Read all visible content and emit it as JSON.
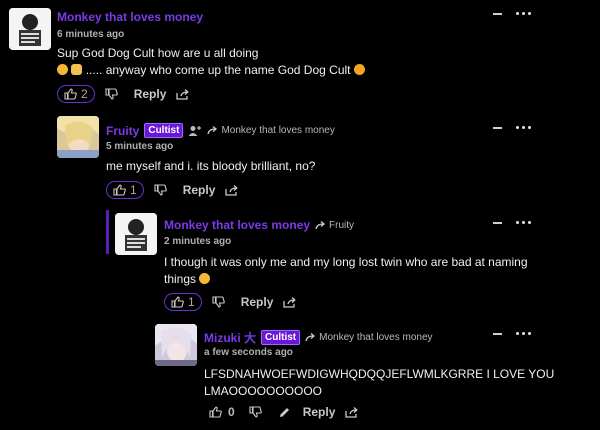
{
  "comments": [
    {
      "author": "Monkey that loves money",
      "time": "6 minutes ago",
      "line1": "Sup God Dog Cult how are u all doing",
      "line2": "..... anyway who come up the name God Dog Cult",
      "likes": "2",
      "reply_label": "Reply"
    },
    {
      "author": "Fruity",
      "badge": "Cultist",
      "reply_to": "Monkey that loves money",
      "time": "5 minutes ago",
      "line1": "me myself and i. its bloody brilliant, no?",
      "likes": "1",
      "reply_label": "Reply"
    },
    {
      "author": "Monkey that loves money",
      "reply_to": "Fruity",
      "time": "2 minutes ago",
      "line1": "I though it was only me and my long lost twin who are bad at naming",
      "line2": "things",
      "likes": "1",
      "reply_label": "Reply"
    },
    {
      "author": "Mizuki 大",
      "badge": "Cultist",
      "reply_to": "Monkey that loves money",
      "time": "a few seconds ago",
      "line1": "LFSDNAHWOEFWDIGWHQDQQJEFLWMLKGRRE I LOVE YOU",
      "line2": "LMAOOOOOOOOOO",
      "likes": "0",
      "reply_label": "Reply"
    }
  ],
  "colors": {
    "accent": "#6a2fd6",
    "badge": "#6a17d8",
    "background": "#000000"
  }
}
